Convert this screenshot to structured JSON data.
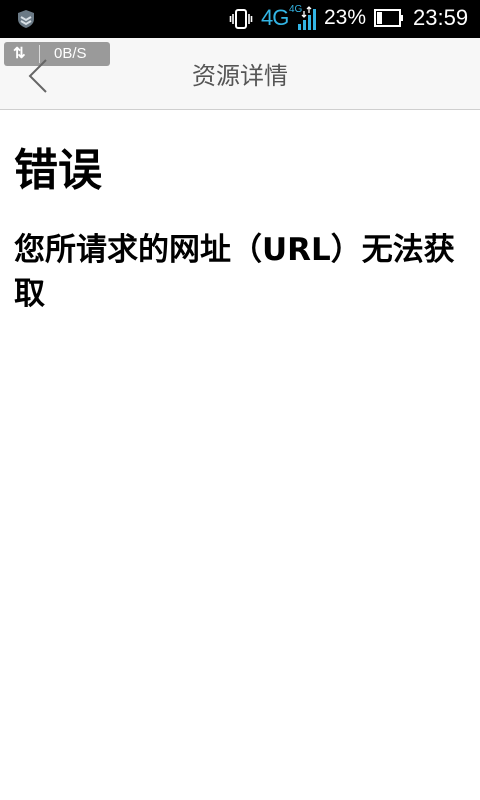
{
  "status_bar": {
    "network_type": "4G",
    "network_type_small": "4G",
    "battery_percent": "23%",
    "time": "23:59"
  },
  "header": {
    "net_speed": "0B/S",
    "net_speed_arrows": "⇅",
    "title": "资源详情"
  },
  "content": {
    "heading": "错误",
    "message": "您所请求的网址（URL）无法获取"
  },
  "colors": {
    "status_bar_bg": "#000000",
    "network_accent": "#33b5e5",
    "header_bg": "#f7f7f7",
    "badge_bg": "#9a9a9a",
    "title_text": "#555555"
  }
}
